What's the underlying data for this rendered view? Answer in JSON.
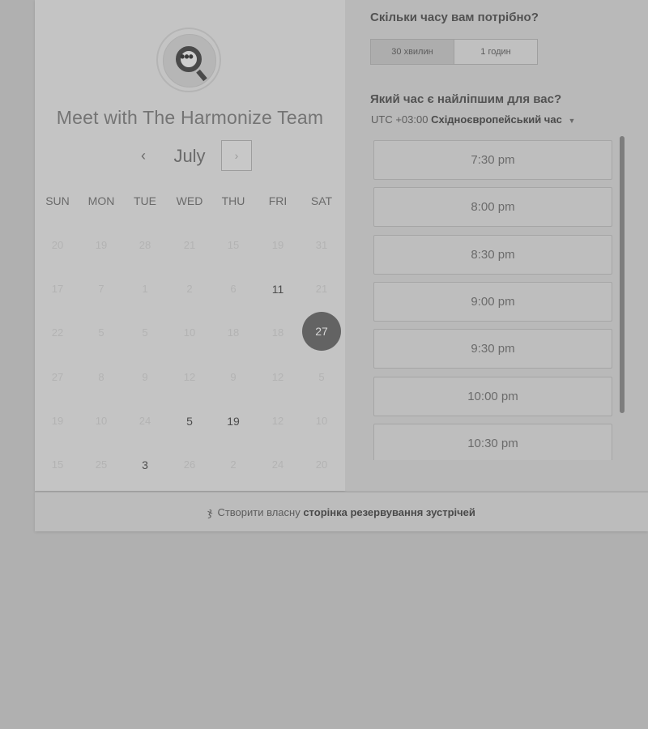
{
  "left_panel": {
    "title": "Meet with The Harmonize Team",
    "month": "July",
    "prev_glyph": "‹",
    "next_glyph": "›",
    "weekdays": [
      "SUN",
      "MON",
      "TUE",
      "WED",
      "THU",
      "FRI",
      "SAT"
    ],
    "weeks": [
      [
        {
          "d": "20",
          "s": "off"
        },
        {
          "d": "19",
          "s": "off"
        },
        {
          "d": "28",
          "s": "off"
        },
        {
          "d": "21",
          "s": "off"
        },
        {
          "d": "15",
          "s": "off"
        },
        {
          "d": "19",
          "s": "off"
        },
        {
          "d": "31",
          "s": "off"
        }
      ],
      [
        {
          "d": "17",
          "s": "off"
        },
        {
          "d": "7",
          "s": "off"
        },
        {
          "d": "1",
          "s": "off"
        },
        {
          "d": "2",
          "s": "off"
        },
        {
          "d": "6",
          "s": "off"
        },
        {
          "d": "11",
          "s": "active"
        },
        {
          "d": "21",
          "s": "off"
        }
      ],
      [
        {
          "d": "22",
          "s": "off"
        },
        {
          "d": "5",
          "s": "off"
        },
        {
          "d": "5",
          "s": "off"
        },
        {
          "d": "10",
          "s": "off"
        },
        {
          "d": "18",
          "s": "off"
        },
        {
          "d": "18",
          "s": "off"
        },
        {
          "d": "27",
          "s": "selected"
        }
      ],
      [
        {
          "d": "27",
          "s": "off"
        },
        {
          "d": "8",
          "s": "off"
        },
        {
          "d": "9",
          "s": "off"
        },
        {
          "d": "12",
          "s": "off"
        },
        {
          "d": "9",
          "s": "off"
        },
        {
          "d": "12",
          "s": "off"
        },
        {
          "d": "5",
          "s": "off"
        }
      ],
      [
        {
          "d": "19",
          "s": "off"
        },
        {
          "d": "10",
          "s": "off"
        },
        {
          "d": "24",
          "s": "off"
        },
        {
          "d": "5",
          "s": "active"
        },
        {
          "d": "19",
          "s": "active"
        },
        {
          "d": "12",
          "s": "off"
        },
        {
          "d": "10",
          "s": "off"
        }
      ],
      [
        {
          "d": "15",
          "s": "off"
        },
        {
          "d": "25",
          "s": "off"
        },
        {
          "d": "3",
          "s": "active"
        },
        {
          "d": "26",
          "s": "off"
        },
        {
          "d": "2",
          "s": "off"
        },
        {
          "d": "24",
          "s": "off"
        },
        {
          "d": "20",
          "s": "off"
        }
      ]
    ]
  },
  "right_panel": {
    "duration_question": "Скільки часу вам потрібно?",
    "duration_options": [
      {
        "label": "30 хвилин",
        "selected": true
      },
      {
        "label": "1 годин",
        "selected": false
      }
    ],
    "time_question": "Який час є найліпшим для вас?",
    "timezone_prefix": "UTC +03:00",
    "timezone_name": "Східноєвропейський час",
    "slots": [
      "7:30 pm",
      "8:00 pm",
      "8:30 pm",
      "9:00 pm",
      "9:30 pm",
      "10:00 pm",
      "10:30 pm"
    ]
  },
  "footer": {
    "icon": "hubspot-sprocket-icon",
    "text_plain": "Створити власну",
    "text_bold": "сторінка резервування зустрічей"
  }
}
